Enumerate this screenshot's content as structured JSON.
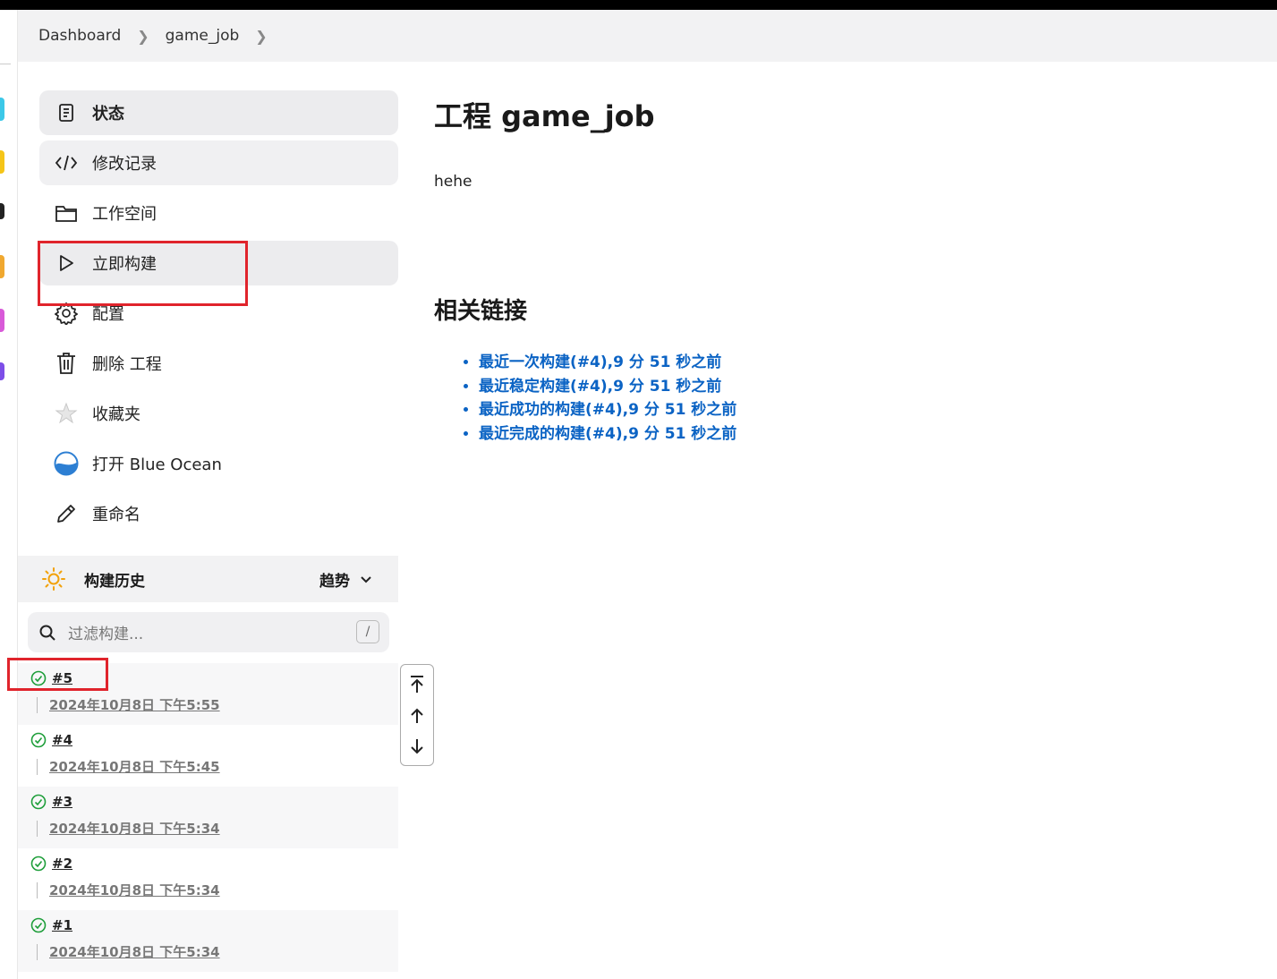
{
  "breadcrumb": {
    "items": [
      "Dashboard",
      "game_job"
    ]
  },
  "sidebar": {
    "items": [
      {
        "label": "状态",
        "icon": "document-icon"
      },
      {
        "label": "修改记录",
        "icon": "code-icon"
      },
      {
        "label": "工作空间",
        "icon": "folder-icon"
      },
      {
        "label": "立即构建",
        "icon": "play-icon"
      },
      {
        "label": "配置",
        "icon": "gear-icon"
      },
      {
        "label": "删除 工程",
        "icon": "trash-icon"
      },
      {
        "label": "收藏夹",
        "icon": "star-icon"
      },
      {
        "label": "打开 Blue Ocean",
        "icon": "blue-ocean-icon"
      },
      {
        "label": "重命名",
        "icon": "pencil-icon"
      }
    ]
  },
  "build_history": {
    "title": "构建历史",
    "trend_label": "趋势",
    "filter_placeholder": "过滤构建...",
    "filter_shortcut": "/",
    "builds": [
      {
        "number": "#5",
        "date": "2024年10月8日 下午5:55",
        "status": "success"
      },
      {
        "number": "#4",
        "date": "2024年10月8日 下午5:45",
        "status": "success"
      },
      {
        "number": "#3",
        "date": "2024年10月8日 下午5:34",
        "status": "success"
      },
      {
        "number": "#2",
        "date": "2024年10月8日 下午5:34",
        "status": "success"
      },
      {
        "number": "#1",
        "date": "2024年10月8日 下午5:34",
        "status": "success"
      }
    ]
  },
  "main": {
    "title": "工程 game_job",
    "description": "hehe",
    "related_title": "相关链接",
    "links": [
      "最近一次构建(#4),9 分 51 秒之前",
      "最近稳定构建(#4),9 分 51 秒之前",
      "最近成功的构建(#4),9 分 51 秒之前",
      "最近完成的构建(#4),9 分 51 秒之前"
    ]
  },
  "colors": {
    "link": "#0b63c4",
    "success": "#1e9e3a",
    "highlight_box": "#e0242c"
  }
}
